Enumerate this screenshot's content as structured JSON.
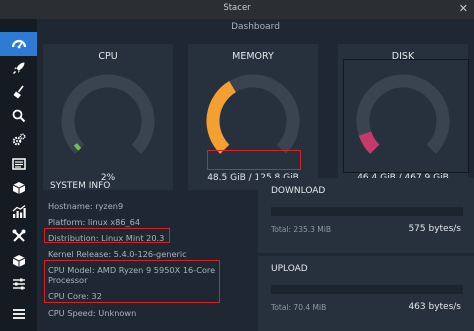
{
  "window": {
    "title": "Stacer",
    "close_glyph": "✕"
  },
  "page_title": "Dashboard",
  "sidebar": {
    "items": [
      {
        "icon": "dashboard-icon",
        "active": true
      },
      {
        "icon": "rocket-icon",
        "active": false
      },
      {
        "icon": "broom-icon",
        "active": false
      },
      {
        "icon": "search-icon",
        "active": false
      },
      {
        "icon": "gears-icon",
        "active": false
      },
      {
        "icon": "processes-icon",
        "active": false
      },
      {
        "icon": "uninstaller-icon",
        "active": false
      },
      {
        "icon": "resources-chart-icon",
        "active": false
      },
      {
        "icon": "helpers-tools-icon",
        "active": false
      },
      {
        "icon": "apt-repository-icon",
        "active": false
      },
      {
        "icon": "gnome-settings-icon",
        "active": false
      },
      {
        "icon": "settings-list-icon",
        "active": false
      }
    ]
  },
  "gauges": {
    "cpu": {
      "label": "CPU",
      "value": "2%",
      "percent": 2,
      "color": "#6cc644"
    },
    "memory": {
      "label": "MEMORY",
      "value": "48.5 GiB / 125.8 GiB",
      "percent": 38.6,
      "color": "#f2a032"
    },
    "disk": {
      "label": "DISK",
      "value": "46.4 GiB / 467.9 GiB",
      "percent": 9.9,
      "color": "#c43a6a"
    }
  },
  "system_info": {
    "heading": "SYSTEM INFO",
    "hostname": "Hostname: ryzen9",
    "platform": "Platform: linux x86_64",
    "distribution": "Distribution: Linux Mint 20.3",
    "kernel": "Kernel Release: 5.4.0-126-generic",
    "cpu_model_line1": "CPU Model:  AMD Ryzen 9 5950X 16-Core",
    "cpu_model_line2": "Processor",
    "cpu_core": "CPU Core: 32",
    "cpu_speed": "CPU Speed: Unknown"
  },
  "download": {
    "label": "DOWNLOAD",
    "total": "Total: 235.3 MiB",
    "rate": "575 bytes/s"
  },
  "upload": {
    "label": "UPLOAD",
    "total": "Total: 70.4 MiB",
    "rate": "463 bytes/s"
  },
  "colors": {
    "accent": "#2d7bd5",
    "highlight": "#d3232a",
    "gauge_track": "#3a4450"
  }
}
